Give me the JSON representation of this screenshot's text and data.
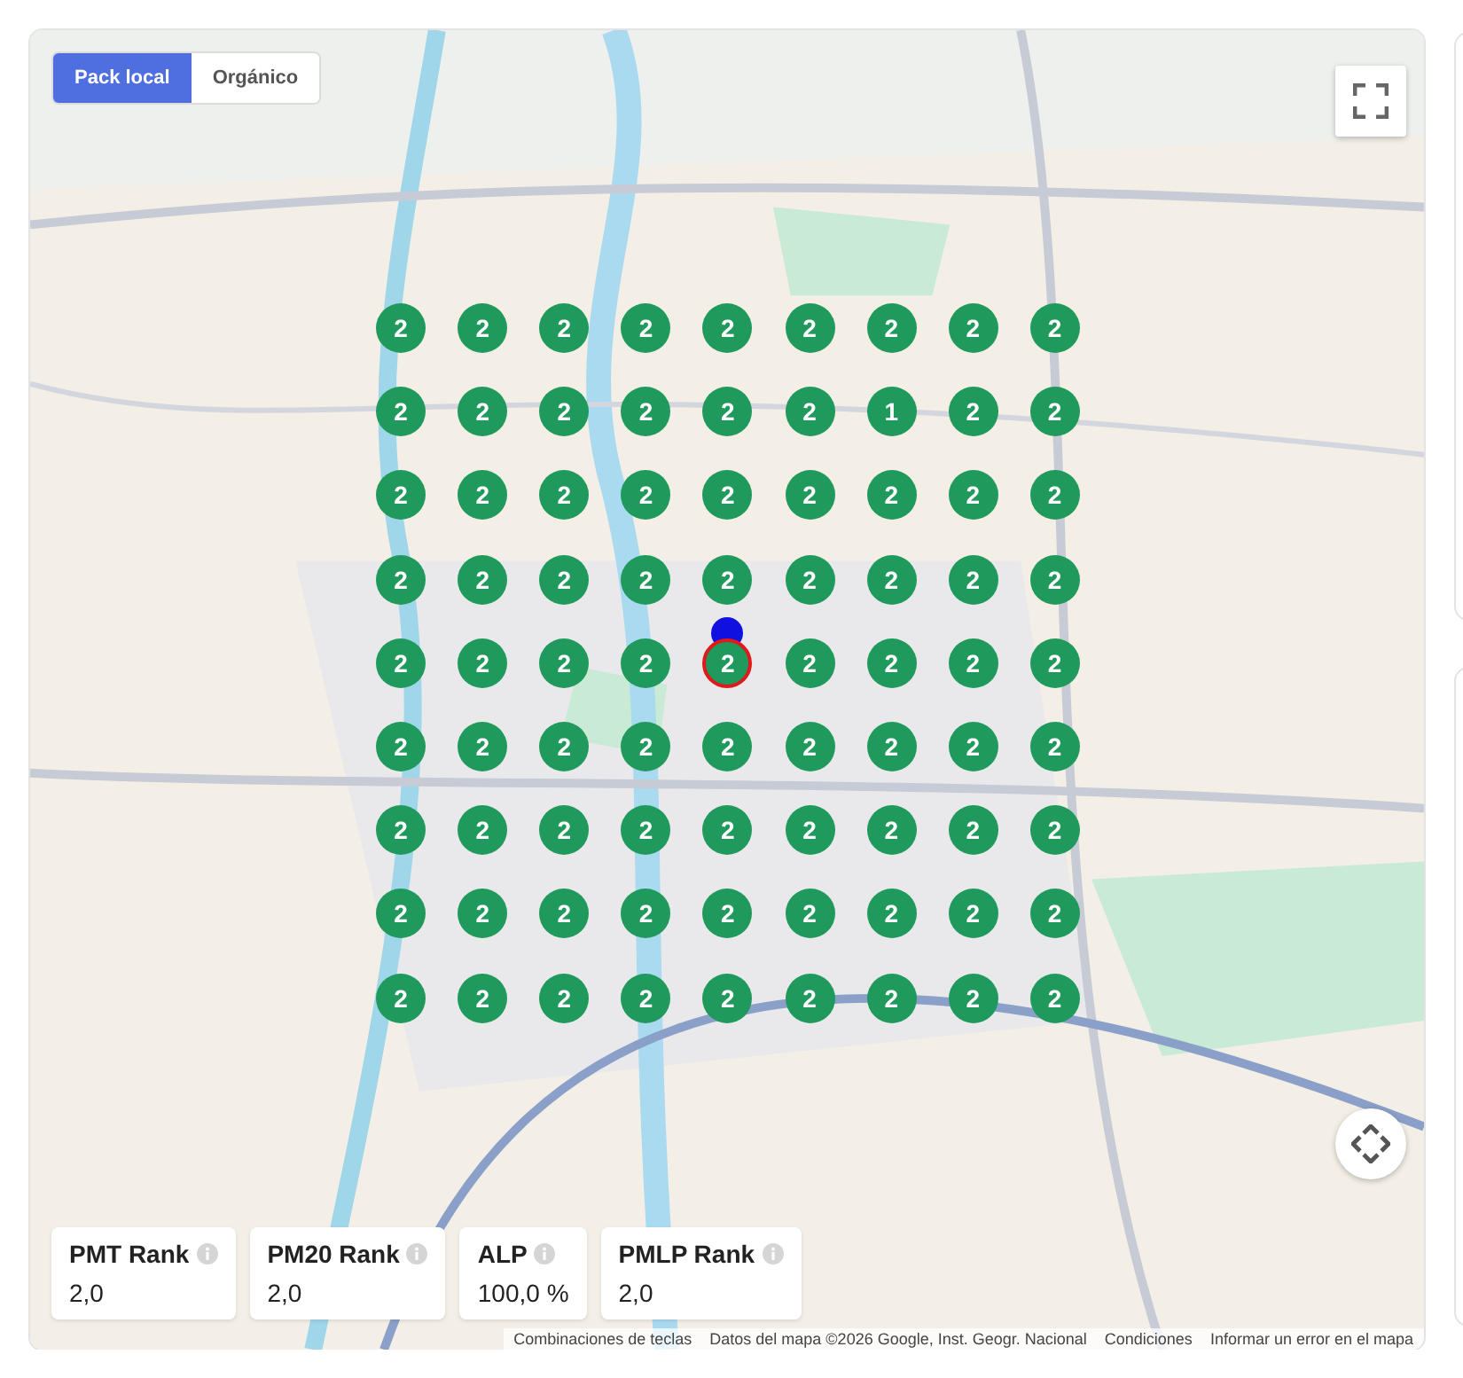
{
  "tabs": [
    {
      "label": "Pack local",
      "selected": true
    },
    {
      "label": "Orgánico",
      "selected": false
    }
  ],
  "grid": [
    [
      {
        "rank": "2",
        "centered": false
      },
      {
        "rank": "2",
        "centered": false
      },
      {
        "rank": "2",
        "centered": false
      },
      {
        "rank": "2",
        "centered": false
      },
      {
        "rank": "2",
        "centered": false
      },
      {
        "rank": "2",
        "centered": false
      },
      {
        "rank": "2",
        "centered": false
      },
      {
        "rank": "2",
        "centered": false
      },
      {
        "rank": "2",
        "centered": false
      }
    ],
    [
      {
        "rank": "2",
        "centered": false
      },
      {
        "rank": "2",
        "centered": false
      },
      {
        "rank": "2",
        "centered": false
      },
      {
        "rank": "2",
        "centered": false
      },
      {
        "rank": "2",
        "centered": false
      },
      {
        "rank": "2",
        "centered": false
      },
      {
        "rank": "1",
        "centered": false
      },
      {
        "rank": "2",
        "centered": false
      },
      {
        "rank": "2",
        "centered": false
      }
    ],
    [
      {
        "rank": "2",
        "centered": false
      },
      {
        "rank": "2",
        "centered": false
      },
      {
        "rank": "2",
        "centered": false
      },
      {
        "rank": "2",
        "centered": false
      },
      {
        "rank": "2",
        "centered": false
      },
      {
        "rank": "2",
        "centered": false
      },
      {
        "rank": "2",
        "centered": false
      },
      {
        "rank": "2",
        "centered": false
      },
      {
        "rank": "2",
        "centered": false
      }
    ],
    [
      {
        "rank": "2",
        "centered": false
      },
      {
        "rank": "2",
        "centered": false
      },
      {
        "rank": "2",
        "centered": false
      },
      {
        "rank": "2",
        "centered": false
      },
      {
        "rank": "2",
        "centered": false
      },
      {
        "rank": "2",
        "centered": false
      },
      {
        "rank": "2",
        "centered": false
      },
      {
        "rank": "2",
        "centered": false
      },
      {
        "rank": "2",
        "centered": false
      }
    ],
    [
      {
        "rank": "2",
        "centered": false
      },
      {
        "rank": "2",
        "centered": false
      },
      {
        "rank": "2",
        "centered": false
      },
      {
        "rank": "2",
        "centered": false
      },
      {
        "rank": "2",
        "centered": true
      },
      {
        "rank": "2",
        "centered": false
      },
      {
        "rank": "2",
        "centered": false
      },
      {
        "rank": "2",
        "centered": false
      },
      {
        "rank": "2",
        "centered": false
      }
    ],
    [
      {
        "rank": "2",
        "centered": false
      },
      {
        "rank": "2",
        "centered": false
      },
      {
        "rank": "2",
        "centered": false
      },
      {
        "rank": "2",
        "centered": false
      },
      {
        "rank": "2",
        "centered": false
      },
      {
        "rank": "2",
        "centered": false
      },
      {
        "rank": "2",
        "centered": false
      },
      {
        "rank": "2",
        "centered": false
      },
      {
        "rank": "2",
        "centered": false
      }
    ],
    [
      {
        "rank": "2",
        "centered": false
      },
      {
        "rank": "2",
        "centered": false
      },
      {
        "rank": "2",
        "centered": false
      },
      {
        "rank": "2",
        "centered": false
      },
      {
        "rank": "2",
        "centered": false
      },
      {
        "rank": "2",
        "centered": false
      },
      {
        "rank": "2",
        "centered": false
      },
      {
        "rank": "2",
        "centered": false
      },
      {
        "rank": "2",
        "centered": false
      }
    ],
    [
      {
        "rank": "2",
        "centered": false
      },
      {
        "rank": "2",
        "centered": false
      },
      {
        "rank": "2",
        "centered": false
      },
      {
        "rank": "2",
        "centered": false
      },
      {
        "rank": "2",
        "centered": false
      },
      {
        "rank": "2",
        "centered": false
      },
      {
        "rank": "2",
        "centered": false
      },
      {
        "rank": "2",
        "centered": false
      },
      {
        "rank": "2",
        "centered": false
      }
    ],
    [
      {
        "rank": "2",
        "centered": false
      },
      {
        "rank": "2",
        "centered": false
      },
      {
        "rank": "2",
        "centered": false
      },
      {
        "rank": "2",
        "centered": false
      },
      {
        "rank": "2",
        "centered": false
      },
      {
        "rank": "2",
        "centered": false
      },
      {
        "rank": "2",
        "centered": false
      },
      {
        "rank": "2",
        "centered": false
      },
      {
        "rank": "2",
        "centered": false
      }
    ]
  ],
  "stats": [
    {
      "label": "PMT Rank",
      "value": "2,0"
    },
    {
      "label": "PM20 Rank",
      "value": "2,0"
    },
    {
      "label": "ALP",
      "value": "100,0 %"
    },
    {
      "label": "PMLP Rank",
      "value": "2,0"
    }
  ],
  "attribution": [
    "Combinaciones de teclas",
    "Datos del mapa ©2026 Google, Inst. Geogr. Nacional",
    "Condiciones",
    "Informar un error en el mapa"
  ]
}
